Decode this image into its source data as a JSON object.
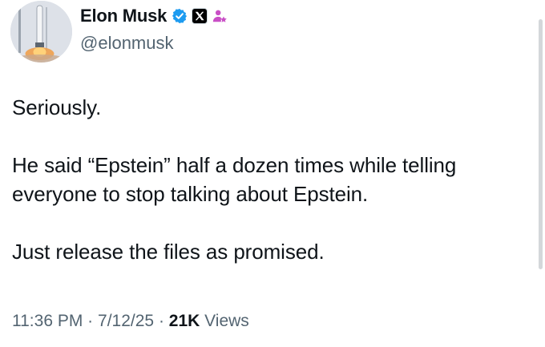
{
  "author": {
    "display_name": "Elon Musk",
    "handle": "@elonmusk",
    "avatar_icon": "rocket-launch-avatar",
    "badges": [
      "verified-icon",
      "x-affiliate-icon",
      "admin-icon"
    ]
  },
  "tweet": {
    "paragraphs": [
      {
        "lines": [
          "Seriously."
        ]
      },
      {
        "lines": [
          "He said “Epstein” half a dozen times while telling",
          "everyone to stop talking about Epstein."
        ]
      },
      {
        "lines": [
          "Just release the files as promised."
        ]
      }
    ]
  },
  "meta": {
    "time": "11:36 PM",
    "separator": "·",
    "date": "7/12/25",
    "views_count": "21K",
    "views_label": "Views"
  },
  "colors": {
    "verified": "#1d9bf0",
    "admin_badge": "#c94fc6",
    "secondary_text": "#536471",
    "primary_text": "#0f1419"
  }
}
